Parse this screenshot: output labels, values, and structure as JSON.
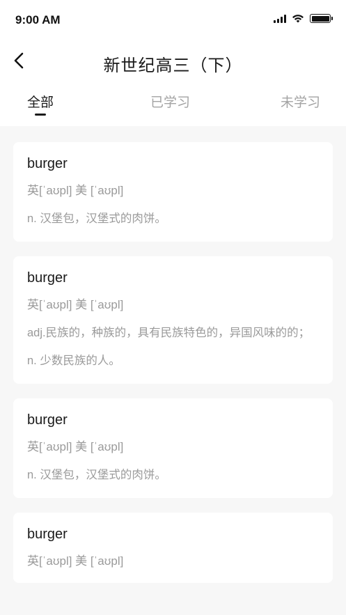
{
  "status_bar": {
    "time": "9:00 AM"
  },
  "nav": {
    "title": "新世纪高三（下）"
  },
  "tabs": [
    {
      "label": "全部",
      "active": true
    },
    {
      "label": "已学习",
      "active": false
    },
    {
      "label": "未学习",
      "active": false
    }
  ],
  "words": [
    {
      "word": "burger",
      "phonetic": "英[ˈaʊpl] 美 [ˈaʊpl]",
      "definitions": [
        "n. 汉堡包，汉堡式的肉饼。"
      ]
    },
    {
      "word": "burger",
      "phonetic": "英[ˈaʊpl] 美 [ˈaʊpl]",
      "definitions": [
        "adj.民族的，种族的，具有民族特色的，异国风味的的；",
        "n. 少数民族的人。"
      ]
    },
    {
      "word": "burger",
      "phonetic": "英[ˈaʊpl] 美 [ˈaʊpl]",
      "definitions": [
        "n. 汉堡包，汉堡式的肉饼。"
      ]
    },
    {
      "word": "burger",
      "phonetic": "英[ˈaʊpl] 美 [ˈaʊpl]",
      "definitions": []
    }
  ],
  "colors": {
    "text_primary": "#1a1a1a",
    "text_secondary": "#9a9a9a",
    "background": "#f7f7f7"
  }
}
